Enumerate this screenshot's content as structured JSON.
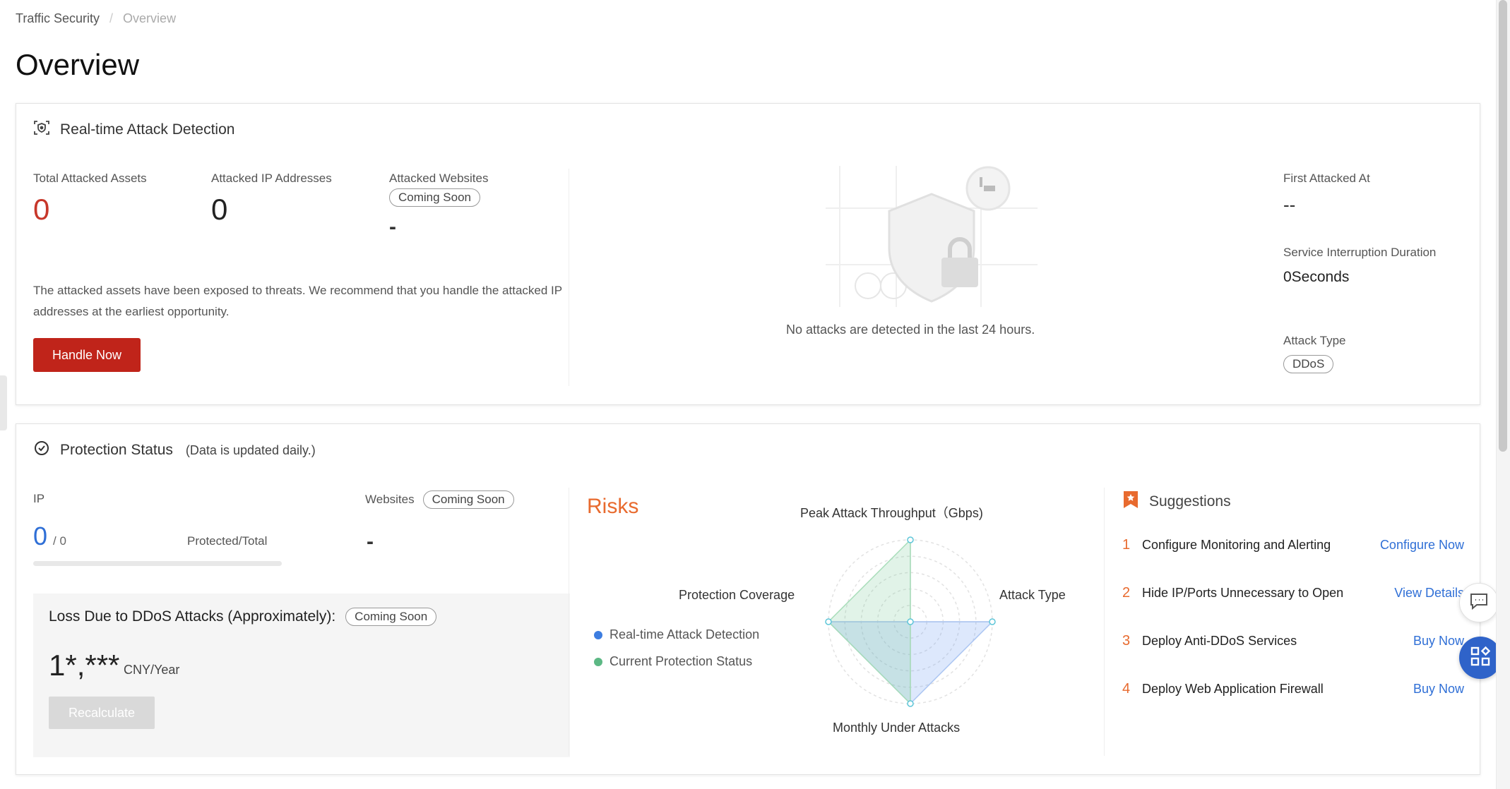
{
  "breadcrumb": {
    "root": "Traffic Security",
    "separator": "/",
    "current": "Overview"
  },
  "page_title": "Overview",
  "attack_detection": {
    "title": "Real-time Attack Detection",
    "total_assets_label": "Total Attacked Assets",
    "total_assets_value": "0",
    "ip_label": "Attacked IP Addresses",
    "ip_value": "0",
    "websites_label": "Attacked Websites",
    "websites_tag": "Coming Soon",
    "websites_value": "-",
    "description": "The attacked assets have been exposed to threats. We recommend that you handle the attacked IP addresses at the earliest opportunity.",
    "handle_button": "Handle Now",
    "empty_message": "No attacks are detected in the last 24 hours.",
    "first_attacked_label": "First Attacked At",
    "first_attacked_value": "--",
    "interruption_label": "Service Interruption Duration",
    "interruption_value": "0Seconds",
    "attack_type_label": "Attack Type",
    "attack_type_value": "DDoS"
  },
  "protection_status": {
    "title": "Protection Status",
    "subtitle": "(Data is updated daily.)",
    "ip_label": "IP",
    "ip_protected": "0",
    "ip_total": "/ 0",
    "ip_ratio_label": "Protected/Total",
    "ip_progress": 0,
    "websites_label": "Websites",
    "websites_tag": "Coming Soon",
    "websites_value": "-",
    "loss_title": "Loss Due to DDoS Attacks (Approximately):",
    "loss_tag": "Coming Soon",
    "loss_value": "1*,***",
    "loss_unit": "CNY/Year",
    "recalculate_button": "Recalculate"
  },
  "risks": {
    "title": "Risks",
    "axes": {
      "top": "Peak Attack Throughput（Gbps)",
      "right": "Attack Type",
      "bottom": "Monthly Under Attacks",
      "left": "Protection Coverage"
    },
    "legend": [
      {
        "label": "Real-time Attack Detection",
        "color": "#3d7de0"
      },
      {
        "label": "Current Protection Status",
        "color": "#5cb884"
      }
    ]
  },
  "chart_data": {
    "type": "radar",
    "axes": [
      "Peak Attack Throughput（Gbps)",
      "Attack Type",
      "Monthly Under Attacks",
      "Protection Coverage"
    ],
    "series": [
      {
        "name": "Real-time Attack Detection",
        "values": [
          0,
          1,
          1,
          1
        ]
      },
      {
        "name": "Current Protection Status",
        "values": [
          1,
          0,
          1,
          1
        ]
      }
    ]
  },
  "suggestions": {
    "title": "Suggestions",
    "items": [
      {
        "num": "1",
        "text": "Configure Monitoring and Alerting",
        "action": "Configure Now"
      },
      {
        "num": "2",
        "text": "Hide IP/Ports Unnecessary to Open",
        "action": "View Details"
      },
      {
        "num": "3",
        "text": "Deploy Anti-DDoS Services",
        "action": "Buy Now"
      },
      {
        "num": "4",
        "text": "Deploy Web Application Firewall",
        "action": "Buy Now"
      }
    ]
  },
  "icons": {
    "detection": "scan-shield-icon",
    "protection": "shield-check-icon",
    "suggestions": "bookmark-star-icon",
    "chat": "chat-icon",
    "apps": "apps-grid-icon"
  },
  "colors": {
    "accent_red": "#c0241a",
    "value_red": "#c7372a",
    "link_blue": "#2f6fd6",
    "risk_orange": "#e86a2e"
  }
}
